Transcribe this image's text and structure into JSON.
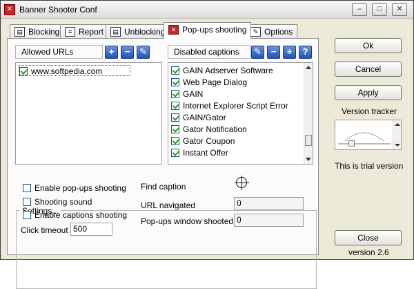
{
  "window": {
    "title": "Banner Shooter Conf",
    "minimize_symbol": "–",
    "maximize_symbol": "□",
    "close_symbol": "✕"
  },
  "tabs": [
    {
      "label": "Blocking",
      "icon": "blocking-icon",
      "active": false
    },
    {
      "label": "Report",
      "icon": "report-icon",
      "active": false
    },
    {
      "label": "Unblocking",
      "icon": "unblocking-icon",
      "active": false
    },
    {
      "label": "Pop-ups shooting",
      "icon": "popups-icon",
      "active": true
    },
    {
      "label": "Options",
      "icon": "options-icon",
      "active": false
    }
  ],
  "allowed_urls": {
    "title": "Allowed URLs",
    "buttons": [
      "+",
      "−",
      "✎"
    ],
    "items": [
      {
        "label": "www.softpedia.com",
        "checked": true
      }
    ]
  },
  "disabled_captions": {
    "title": "Disabled captions",
    "buttons": [
      "✎",
      "−",
      "+",
      "?"
    ],
    "items": [
      {
        "label": "GAIN Adserver Software",
        "checked": true
      },
      {
        "label": "Web Page Dialog",
        "checked": true
      },
      {
        "label": "GAIN",
        "checked": true
      },
      {
        "label": "Internet Explorer Script Error",
        "checked": true
      },
      {
        "label": "GAIN/Gator",
        "checked": true
      },
      {
        "label": "Gator Notification",
        "checked": true
      },
      {
        "label": "Gator Coupon",
        "checked": true
      },
      {
        "label": "Instant Offer",
        "checked": true
      }
    ]
  },
  "settings": {
    "title": "Settings...",
    "enable_popups_label": "Enable pop-ups shooting",
    "shooting_sound_label": "Shooting sound",
    "enable_captions_label": "Enable captions shooting",
    "click_timeout_label": "Click timeout",
    "click_timeout_value": "500",
    "find_caption_label": "Find caption",
    "url_navigated_label": "URL navigated",
    "url_navigated_value": "0",
    "popups_shot_label": "Pop-ups window shooted",
    "popups_shot_value": "0"
  },
  "right": {
    "ok_label": "Ok",
    "cancel_label": "Cancel",
    "apply_label": "Apply",
    "version_tracker_label": "Version tracker",
    "trial_text": "This is trial version",
    "close_label": "Close",
    "version_text": "version 2.6"
  }
}
